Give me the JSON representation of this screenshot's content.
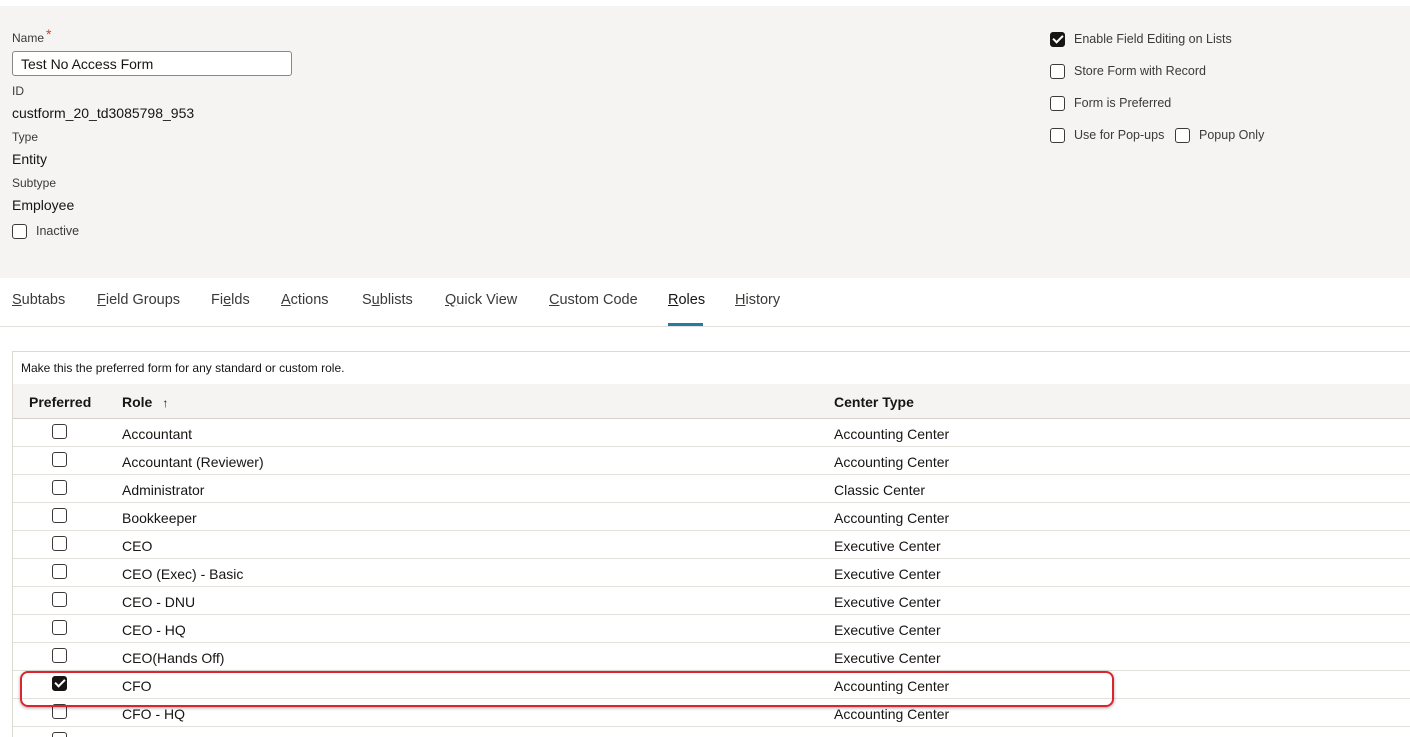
{
  "form": {
    "name_label": "Name",
    "required_mark": "*",
    "name_value": "Test No Access Form",
    "id_label": "ID",
    "id_value": "custform_20_td3085798_953",
    "type_label": "Type",
    "type_value": "Entity",
    "subtype_label": "Subtype",
    "subtype_value": "Employee",
    "inactive_label": "Inactive",
    "inactive_checked": false
  },
  "options": {
    "enable_field_editing": {
      "label": "Enable Field Editing on Lists",
      "checked": true
    },
    "store_form": {
      "label": "Store Form with Record",
      "checked": false
    },
    "form_preferred": {
      "label": "Form is Preferred",
      "checked": false
    },
    "use_popups": {
      "label": "Use for Pop-ups",
      "checked": false
    },
    "popup_only": {
      "label": "Popup Only",
      "checked": false
    }
  },
  "tabs": [
    {
      "first": "S",
      "rest": "ubtabs"
    },
    {
      "first": "F",
      "rest": "ield Groups"
    },
    {
      "pre": "Fi",
      "first": "e",
      "rest": "lds"
    },
    {
      "first": "A",
      "rest": "ctions"
    },
    {
      "pre": "S",
      "first": "u",
      "rest": "blists"
    },
    {
      "first": "Q",
      "rest": "uick View"
    },
    {
      "first": "C",
      "rest": "ustom Code"
    },
    {
      "first": "R",
      "rest": "oles"
    },
    {
      "first": "H",
      "rest": "istory"
    }
  ],
  "active_tab": "Roles",
  "roles_table": {
    "note": "Make this the preferred form for any standard or custom role.",
    "columns": {
      "preferred": "Preferred",
      "role": "Role",
      "sort_indicator": "↑",
      "center_type": "Center Type"
    },
    "rows": [
      {
        "preferred": false,
        "role": "Accountant",
        "center": "Accounting Center"
      },
      {
        "preferred": false,
        "role": "Accountant (Reviewer)",
        "center": "Accounting Center"
      },
      {
        "preferred": false,
        "role": "Administrator",
        "center": "Classic Center"
      },
      {
        "preferred": false,
        "role": "Bookkeeper",
        "center": "Accounting Center"
      },
      {
        "preferred": false,
        "role": "CEO",
        "center": "Executive Center"
      },
      {
        "preferred": false,
        "role": "CEO (Exec) - Basic",
        "center": "Executive Center"
      },
      {
        "preferred": false,
        "role": "CEO - DNU",
        "center": "Executive Center"
      },
      {
        "preferred": false,
        "role": "CEO - HQ",
        "center": "Executive Center"
      },
      {
        "preferred": false,
        "role": "CEO(Hands Off)",
        "center": "Executive Center"
      },
      {
        "preferred": true,
        "role": "CFO",
        "center": "Accounting Center"
      },
      {
        "preferred": false,
        "role": "CFO - HQ",
        "center": "Accounting Center"
      },
      {
        "preferred": false,
        "role": "",
        "center": ""
      }
    ]
  },
  "colors": {
    "accent": "#227e9e",
    "highlight": "#d9262c",
    "panel": "#f6f4f2"
  }
}
